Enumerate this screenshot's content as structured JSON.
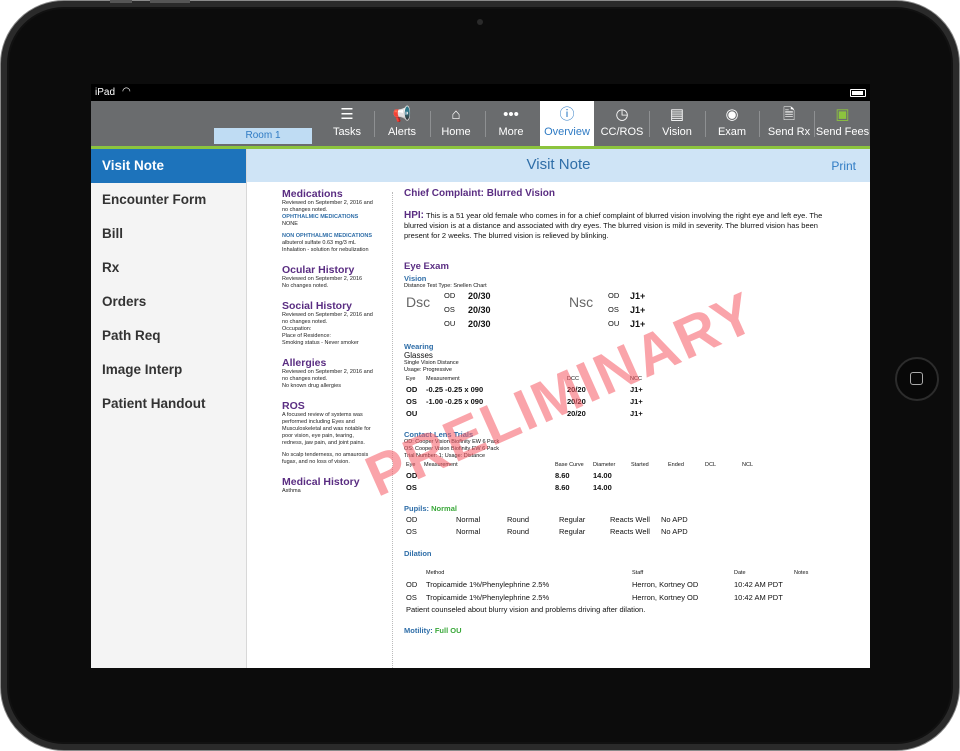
{
  "status": {
    "carrier": "iPad"
  },
  "toolbar": {
    "room": "Room 1",
    "buttons": [
      {
        "label": "Tasks"
      },
      {
        "label": "Alerts"
      },
      {
        "label": "Home"
      },
      {
        "label": "More"
      },
      {
        "label": "Overview"
      },
      {
        "label": "CC/ROS"
      },
      {
        "label": "Vision"
      },
      {
        "label": "Exam"
      },
      {
        "label": "Send Rx"
      },
      {
        "label": "Send Fees"
      }
    ]
  },
  "sidebar": {
    "items": [
      {
        "label": "Visit Note"
      },
      {
        "label": "Encounter Form"
      },
      {
        "label": "Bill"
      },
      {
        "label": "Rx"
      },
      {
        "label": "Orders"
      },
      {
        "label": "Path Req"
      },
      {
        "label": "Image Interp"
      },
      {
        "label": "Patient Handout"
      }
    ]
  },
  "header": {
    "title": "Visit Note",
    "print": "Print"
  },
  "left": {
    "medications": {
      "title": "Medications",
      "l1": "Reviewed on September 2, 2016  and",
      "l2": "no changes noted.",
      "oph_h": "OPHTHALMIC MEDICATIONS",
      "oph_v": "NONE",
      "non_h": "NON OPHTHALMIC MEDICATIONS",
      "non_v1": "albuterol sulfate 0.63 mg/3 mL",
      "non_v2": "Inhalation - solution for nebulization"
    },
    "ocular": {
      "title": "Ocular History",
      "l1": "Reviewed on September 2, 2016",
      "l2": "No changes noted."
    },
    "social": {
      "title": "Social History",
      "l1": "Reviewed on September 2, 2016  and",
      "l2": "no changes noted.",
      "l3": "Occupation:",
      "l4": "Place of Residence:",
      "l5": "Smoking status - Never smoker"
    },
    "allergies": {
      "title": "Allergies",
      "l1": "Reviewed on September 2, 2016 and",
      "l2": "no changes noted.",
      "l3": "No known drug allergies"
    },
    "ros": {
      "title": "ROS",
      "l1": "A focused review of systems was",
      "l2": "performed including Eyes and",
      "l3": "Musculoskeletal and was notable for",
      "l4": "poor vision, eye pain, tearing,",
      "l5": "redness, jaw pain, and joint pains.",
      "l6": "No scalp tenderness, no amaurosis",
      "l7": "fugax, and no loss of vision."
    },
    "medical": {
      "title": "Medical History",
      "l1": "Asthma"
    }
  },
  "right": {
    "cc": "Chief Complaint: Blurred Vision",
    "hpi_label": "HPI:",
    "hpi_text": " This is a 51 year old female who comes in for a chief complaint of blurred vision involving the right eye and left eye. The blurred vision is at a distance and associated with dry eyes. The blurred vision is mild in severity. The blurred vision has been present for 2 weeks. The blurred vision is relieved by blinking.",
    "eye_exam": "Eye Exam",
    "vision": {
      "title": "Vision",
      "test": "Distance Test Type: Snellen Chart",
      "dsc": "Dsc",
      "nsc": "Nsc",
      "rows": [
        {
          "eye": "OD",
          "d": "20/30",
          "n": "J1+"
        },
        {
          "eye": "OS",
          "d": "20/30",
          "n": "J1+"
        },
        {
          "eye": "OU",
          "d": "20/30",
          "n": "J1+"
        }
      ]
    },
    "wearing": {
      "title": "Wearing",
      "type": "Glasses",
      "sv": "Single Vision Distance",
      "usage": "Usage: Progressive",
      "h_eye": "Eye",
      "h_meas": "Measurement",
      "h_dcc": "DCC",
      "h_ncc": "NCC",
      "rows": [
        {
          "eye": "OD",
          "m": "-0.25 -0.25 x 090",
          "dcc": "20/20",
          "ncc": "J1+"
        },
        {
          "eye": "OS",
          "m": "-1.00 -0.25 x 090",
          "dcc": "20/20",
          "ncc": "J1+"
        },
        {
          "eye": "OU",
          "m": "",
          "dcc": "20/20",
          "ncc": "J1+"
        }
      ]
    },
    "contact": {
      "title": "Contact Lens Trials",
      "l1": "OD: Cooper Vision Biofinity EW 6 Pack",
      "l2": "OS: Cooper Vision Biofinity EW 6 Pack",
      "l3": "Trial Number: 1; Usage: Distance",
      "h_eye": "Eye",
      "h_meas": "Measurement",
      "h_bc": "Base Curve",
      "h_dia": "Diameter",
      "h_start": "Started",
      "h_end": "Ended",
      "h_dcl": "DCL",
      "h_ncl": "NCL",
      "rows": [
        {
          "eye": "OD",
          "bc": "8.60",
          "dia": "14.00"
        },
        {
          "eye": "OS",
          "bc": "8.60",
          "dia": "14.00"
        }
      ]
    },
    "pupils": {
      "label": "Pupils:",
      "value": "Normal",
      "rows": [
        {
          "eye": "OD",
          "a": "Normal",
          "b": "Round",
          "c": "Regular",
          "d": "Reacts Well",
          "e": "No APD"
        },
        {
          "eye": "OS",
          "a": "Normal",
          "b": "Round",
          "c": "Regular",
          "d": "Reacts Well",
          "e": "No APD"
        }
      ]
    },
    "dilation": {
      "title": "Dilation",
      "h_method": "Method",
      "h_staff": "Staff",
      "h_date": "Date",
      "h_notes": "Notes",
      "rows": [
        {
          "eye": "OD",
          "method": "Tropicamide 1%/Phenylephrine 2.5%",
          "staff": "Herron, Kortney OD",
          "date": "10:42 AM PDT"
        },
        {
          "eye": "OS",
          "method": "Tropicamide 1%/Phenylephrine 2.5%",
          "staff": "Herron, Kortney OD",
          "date": "10:42 AM PDT"
        }
      ],
      "note": "Patient counseled about blurry vision and problems driving after dilation."
    },
    "motility": {
      "label": "Motility:",
      "value": "Full OU"
    }
  },
  "watermark": "PRELIMINARY"
}
